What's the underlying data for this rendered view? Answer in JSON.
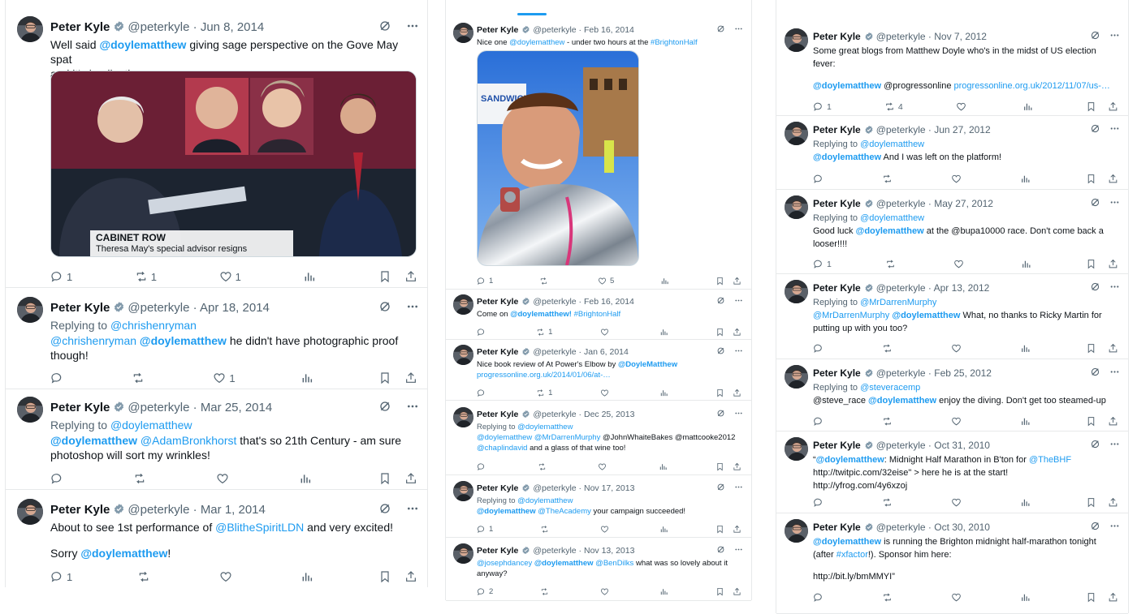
{
  "author": {
    "name": "Peter Kyle",
    "handle": "@peterkyle"
  },
  "colors": {
    "accent": "#1d9bf0",
    "muted": "#536471",
    "text": "#0f1419",
    "border": "#e7e9ea"
  },
  "columns": [
    [
      {
        "date": "Jun 8, 2014",
        "body": [
          [
            [
              "Well said ",
              "t"
            ],
            [
              "@doylematthew",
              "m"
            ],
            [
              " giving sage perspective on the Gove May spat",
              "t"
            ]
          ],
          [
            [
              "and it's implications",
              "t"
            ]
          ]
        ],
        "media": {
          "caption_line1": "CABINET ROW",
          "caption_line2": "Theresa May's special advisor resigns"
        },
        "stats": {
          "reply": "1",
          "retweet": "1",
          "like": "1"
        }
      },
      {
        "date": "Apr 18, 2014",
        "replying_to": "@chrishenryman",
        "body": [
          [
            [
              "@chrishenryman ",
              "l"
            ],
            [
              "@doylematthew",
              "m"
            ],
            [
              " he didn't have photographic proof",
              "t"
            ]
          ],
          [
            [
              "though!",
              "t"
            ]
          ]
        ],
        "stats": {
          "reply": "",
          "retweet": "",
          "like": "1"
        }
      },
      {
        "date": "Mar 25, 2014",
        "replying_to": "@doylematthew",
        "body": [
          [
            [
              "@doylematthew",
              "m"
            ],
            [
              " @AdamBronkhorst",
              "l"
            ],
            [
              " that's so 21th Century - am sure",
              "t"
            ]
          ],
          [
            [
              "photoshop will sort my wrinkles!",
              "t"
            ]
          ]
        ],
        "stats": {
          "reply": "",
          "retweet": "",
          "like": ""
        }
      },
      {
        "date": "Mar 1, 2014",
        "body": [
          [
            [
              "About to see 1st performance of ",
              "t"
            ],
            [
              "@BlitheSpiritLDN",
              "l"
            ],
            [
              " and very excited!",
              "t"
            ]
          ],
          [],
          [
            [
              "Sorry ",
              "t"
            ],
            [
              "@doylematthew",
              "m"
            ],
            [
              "!",
              "t"
            ]
          ]
        ],
        "stats": {
          "reply": "1",
          "retweet": "",
          "like": ""
        }
      }
    ],
    [
      {
        "date": "Feb 16, 2014",
        "body": [
          [
            [
              "Nice one ",
              "t"
            ],
            [
              "@doylematthew",
              "l"
            ],
            [
              " - under two hours at the ",
              "t"
            ],
            [
              "#BrightonHalf",
              "l"
            ]
          ]
        ],
        "media": {
          "sign_text": "SANDWICH"
        },
        "stats": {
          "reply": "1",
          "retweet": "",
          "like": "5"
        }
      },
      {
        "date": "Feb 16, 2014",
        "body": [
          [
            [
              "Come on ",
              "t"
            ],
            [
              "@doylematthew!",
              "m"
            ],
            [
              " #BrightonHalf",
              "l"
            ]
          ]
        ],
        "stats": {
          "reply": "",
          "retweet": "1",
          "like": ""
        }
      },
      {
        "date": "Jan 6, 2014",
        "body": [
          [
            [
              "Nice book review of At Power's Elbow by ",
              "t"
            ],
            [
              "@DoyleMatthew",
              "m"
            ]
          ],
          [
            [
              "progressonline.org.uk/2014/01/06/at-…",
              "l"
            ]
          ]
        ],
        "stats": {
          "reply": "",
          "retweet": "1",
          "like": ""
        }
      },
      {
        "date": "Dec 25, 2013",
        "replying_to": "@doylematthew",
        "body": [
          [
            [
              "@doylematthew",
              "l"
            ],
            [
              " @MrDarrenMurphy",
              "l"
            ],
            [
              " @JohnWhaiteBakes @mattcooke2012",
              "t"
            ]
          ],
          [
            [
              "@chaplindavid",
              "l"
            ],
            [
              " and a glass of that wine too!",
              "t"
            ]
          ]
        ],
        "stats": {
          "reply": "",
          "retweet": "",
          "like": ""
        }
      },
      {
        "date": "Nov 17, 2013",
        "replying_to": "@doylematthew",
        "body": [
          [
            [
              "@doylematthew",
              "m"
            ],
            [
              " @TheAcademy",
              "l"
            ],
            [
              " your campaign succeeded!",
              "t"
            ]
          ]
        ],
        "stats": {
          "reply": "1",
          "retweet": "",
          "like": ""
        }
      },
      {
        "date": "Nov 13, 2013",
        "body": [
          [
            [
              "@josephdancey",
              "l"
            ],
            [
              " @doylematthew",
              "m"
            ],
            [
              " @BenDilks",
              "l"
            ],
            [
              " what was so lovely about it",
              "t"
            ]
          ],
          [
            [
              "anyway?",
              "t"
            ]
          ]
        ],
        "stats": {
          "reply": "2",
          "retweet": "",
          "like": ""
        }
      }
    ],
    [
      {
        "date": "Nov 7, 2012",
        "body": [
          [
            [
              "Some great blogs from Matthew Doyle who's in the midst of US election",
              "t"
            ]
          ],
          [
            [
              "fever:",
              "t"
            ]
          ],
          [],
          [
            [
              "@doylematthew",
              "m"
            ],
            [
              " @progressonline ",
              "t"
            ],
            [
              "progressonline.org.uk/2012/11/07/us-…",
              "l"
            ]
          ]
        ],
        "stats": {
          "reply": "1",
          "retweet": "4",
          "like": ""
        }
      },
      {
        "date": "Jun 27, 2012",
        "replying_to": "@doylematthew",
        "body": [
          [
            [
              "@doylematthew",
              "m"
            ],
            [
              " And I was left on the platform!",
              "t"
            ]
          ]
        ],
        "stats": {
          "reply": "",
          "retweet": "",
          "like": ""
        }
      },
      {
        "date": "May 27, 2012",
        "replying_to": "@doylematthew",
        "body": [
          [
            [
              "Good luck ",
              "t"
            ],
            [
              "@doylematthew",
              "m"
            ],
            [
              " at the @bupa10000 race. Don't come back a",
              "t"
            ]
          ],
          [
            [
              "looser!!!!",
              "t"
            ]
          ]
        ],
        "stats": {
          "reply": "1",
          "retweet": "",
          "like": ""
        }
      },
      {
        "date": "Apr 13, 2012",
        "replying_to": "@MrDarrenMurphy",
        "body": [
          [
            [
              "@MrDarrenMurphy",
              "l"
            ],
            [
              " @doylematthew",
              "m"
            ],
            [
              " What, no thanks to Ricky Martin for",
              "t"
            ]
          ],
          [
            [
              "putting up with you too?",
              "t"
            ]
          ]
        ],
        "stats": {
          "reply": "",
          "retweet": "",
          "like": ""
        }
      },
      {
        "date": "Feb 25, 2012",
        "replying_to": "@steveracemp",
        "body": [
          [
            [
              "@steve_race ",
              "t"
            ],
            [
              "@doylematthew",
              "m"
            ],
            [
              " enjoy the diving. Don't get too steamed-up",
              "t"
            ]
          ]
        ],
        "stats": {
          "reply": "",
          "retweet": "",
          "like": ""
        }
      },
      {
        "date": "Oct 31, 2010",
        "body": [
          [
            [
              "“",
              "t"
            ],
            [
              "@doylematthew",
              "m"
            ],
            [
              ": Midnight Half Marathon in B'ton for ",
              "t"
            ],
            [
              "@TheBHF",
              "l"
            ]
          ],
          [
            [
              "http://twitpic.com/32eise\" > here he is at the start!",
              "t"
            ]
          ],
          [
            [
              "http://yfrog.com/4y6xzoj",
              "t"
            ]
          ]
        ],
        "stats": {
          "reply": "",
          "retweet": "",
          "like": ""
        }
      },
      {
        "date": "Oct 30, 2010",
        "body": [
          [
            [
              "@doylematthew",
              "m"
            ],
            [
              " is running the Brighton midnight half-marathon tonight",
              "t"
            ]
          ],
          [
            [
              "(after ",
              "t"
            ],
            [
              "#xfactor",
              "l"
            ],
            [
              "!). Sponsor him here:",
              "t"
            ]
          ],
          [],
          [
            [
              "http://bit.ly/bmMMYI”",
              "t"
            ]
          ]
        ],
        "stats": {
          "reply": "",
          "retweet": "",
          "like": ""
        }
      }
    ]
  ]
}
